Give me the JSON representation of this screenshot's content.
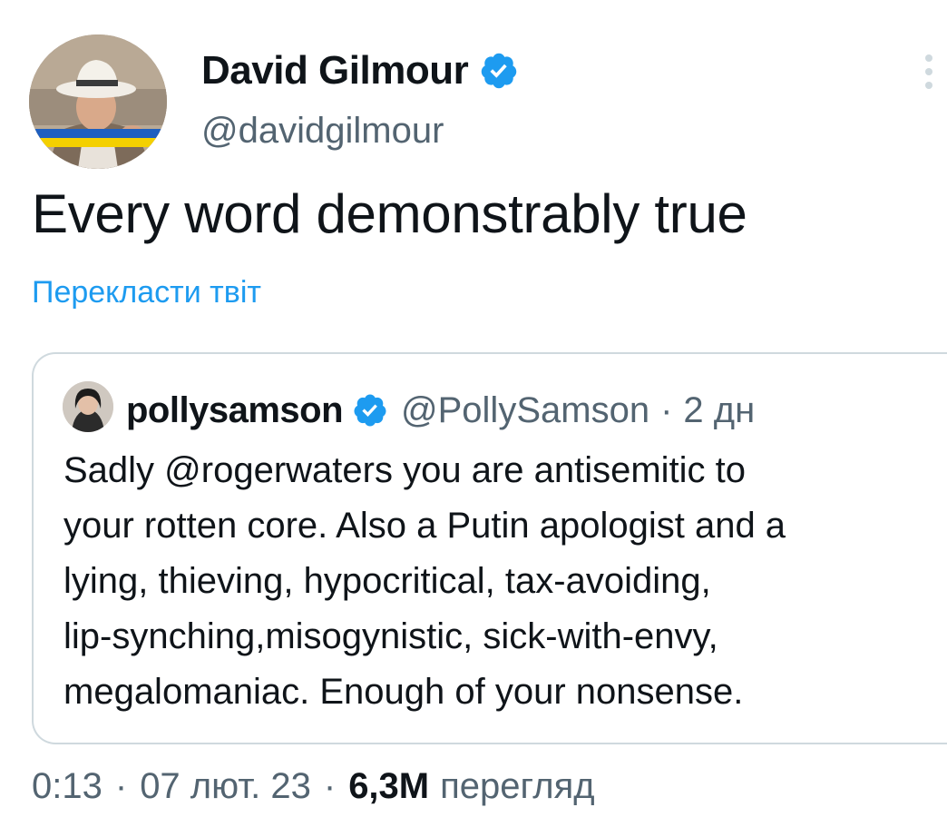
{
  "author": {
    "name": "David Gilmour",
    "handle": "@davidgilmour"
  },
  "tweet": {
    "text": "Every word demonstrably true",
    "translate_label": "Перекласти твіт"
  },
  "quote": {
    "name": "pollysamson",
    "handle": "@PollySamson",
    "separator": "·",
    "time": "2 дн",
    "lines": [
      "Sadly @rogerwaters you are antisemitic to",
      "your rotten core. Also a Putin apologist and a",
      "lying, thieving, hypocritical, tax-avoiding,",
      "lip-synching,misogynistic, sick-with-envy,",
      "megalomaniac. Enough of your nonsense."
    ]
  },
  "meta": {
    "time": "0:13",
    "separator": "·",
    "date": "07 лют. 23",
    "views_count": "6,3M",
    "views_label": "перегляд"
  },
  "icons": {
    "verified": "verified-badge-icon",
    "more": "more-vertical-icon"
  },
  "colors": {
    "accent": "#1d9bf0",
    "text": "#0f1419",
    "secondary": "#536471",
    "border": "#cfd9de",
    "flag_blue": "#1f5fbf",
    "flag_yellow": "#f4d000"
  }
}
